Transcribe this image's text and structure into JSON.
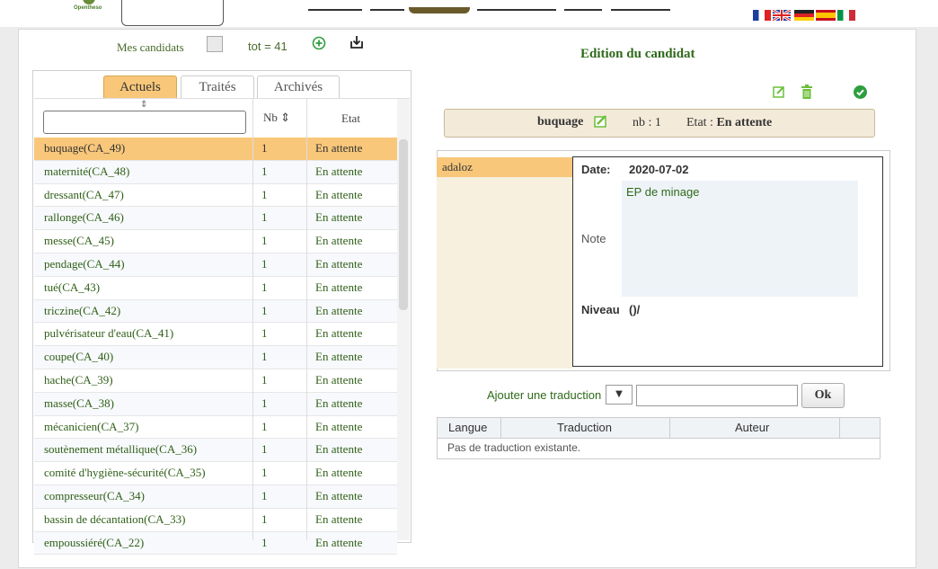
{
  "header": {
    "logo_text": "Opentheso"
  },
  "left": {
    "mes_candidats_label": "Mes candidats",
    "total_label": "tot = 41",
    "tabs": [
      {
        "label": "Actuels",
        "active": true
      },
      {
        "label": "Traités",
        "active": false
      },
      {
        "label": "Archivés",
        "active": false
      }
    ],
    "columns": {
      "nb": "Nb ⇕",
      "etat": "Etat"
    },
    "sort_glyph": "⇕",
    "rows": [
      {
        "name": "buquage(CA_49)",
        "nb": "1",
        "etat": "En attente",
        "selected": true
      },
      {
        "name": "maternité(CA_48)",
        "nb": "1",
        "etat": "En attente"
      },
      {
        "name": "dressant(CA_47)",
        "nb": "1",
        "etat": "En attente"
      },
      {
        "name": "rallonge(CA_46)",
        "nb": "1",
        "etat": "En attente"
      },
      {
        "name": "messe(CA_45)",
        "nb": "1",
        "etat": "En attente"
      },
      {
        "name": "pendage(CA_44)",
        "nb": "1",
        "etat": "En attente"
      },
      {
        "name": "tué(CA_43)",
        "nb": "1",
        "etat": "En attente"
      },
      {
        "name": "triczine(CA_42)",
        "nb": "1",
        "etat": "En attente"
      },
      {
        "name": "pulvérisateur d'eau(CA_41)",
        "nb": "1",
        "etat": "En attente"
      },
      {
        "name": "coupe(CA_40)",
        "nb": "1",
        "etat": "En attente"
      },
      {
        "name": "hache(CA_39)",
        "nb": "1",
        "etat": "En attente"
      },
      {
        "name": "masse(CA_38)",
        "nb": "1",
        "etat": "En attente"
      },
      {
        "name": "mécanicien(CA_37)",
        "nb": "1",
        "etat": "En attente"
      },
      {
        "name": "soutènement métallique(CA_36)",
        "nb": "1",
        "etat": "En attente"
      },
      {
        "name": "comité d'hygiène-sécurité(CA_35)",
        "nb": "1",
        "etat": "En attente"
      },
      {
        "name": "compresseur(CA_34)",
        "nb": "1",
        "etat": "En attente"
      },
      {
        "name": "bassin de décantation(CA_33)",
        "nb": "1",
        "etat": "En attente"
      },
      {
        "name": "empoussiéré(CA_22)",
        "nb": "1",
        "etat": "En attente"
      }
    ]
  },
  "right": {
    "title": "Edition du candidat",
    "candidate": {
      "name": "buquage",
      "nb_label": "nb : 1",
      "etat_label": "Etat :",
      "etat_value": "En attente"
    },
    "message": {
      "user": "adaloz",
      "date_label": "Date:",
      "date_value": "2020-07-02",
      "note_label": "Note",
      "note_value": "EP de minage",
      "niveau_label": "Niveau",
      "niveau_value": "()/"
    },
    "add_translation_label": "Ajouter une traduction",
    "lang_select_value": "▼",
    "ok_label": "Ok",
    "translation_table": {
      "headers": [
        "Langue",
        "Traduction",
        "Auteur"
      ],
      "empty_text": "Pas de traduction existante."
    }
  },
  "colors": {
    "accent": "#f8c77a",
    "link_green": "#2f5f17",
    "title_green": "#2f6a1a"
  }
}
